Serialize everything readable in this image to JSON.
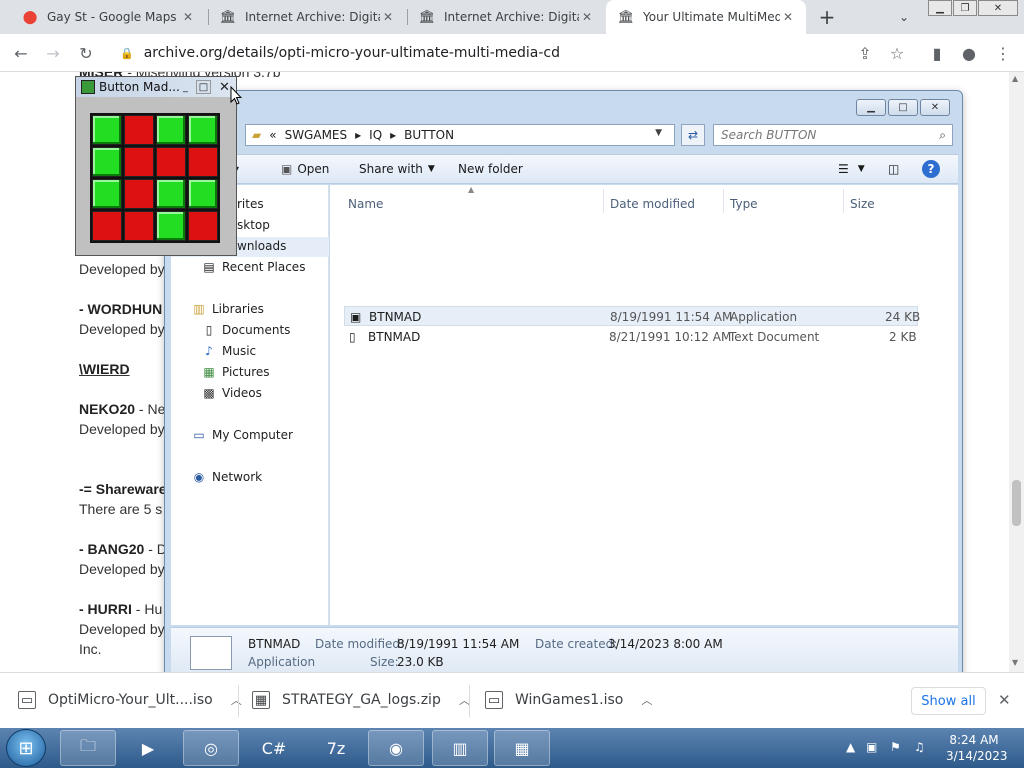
{
  "tabs": [
    {
      "label": "Gay St - Google Maps",
      "icon": "maps-pin-icon"
    },
    {
      "label": "Internet Archive: Digital L",
      "icon": "archive-icon"
    },
    {
      "label": "Internet Archive: Digital L",
      "icon": "archive-icon"
    },
    {
      "label": "Your Ultimate MultiMedia",
      "icon": "archive-icon",
      "active": true
    }
  ],
  "address": "archive.org/details/opti-micro-your-ultimate-multi-media-cd",
  "page": {
    "lines": [
      {
        "bold": "MISER",
        "text": " - MiserMind version 3.7b"
      },
      {
        "bold": "",
        "text": "Developed by"
      },
      {
        "bold": "- WORDHUN",
        "text": ""
      },
      {
        "bold": "",
        "text": "Developed by"
      },
      {
        "bold": "\\WIERD",
        "text": ""
      },
      {
        "bold": "NEKO20",
        "text": " - Ne"
      },
      {
        "bold": "",
        "text": "Developed by"
      },
      {
        "bold": "-= Shareware",
        "text": ""
      },
      {
        "bold": "",
        "text": "There are 5 s"
      },
      {
        "bold": "- BANG20",
        "text": " - D"
      },
      {
        "bold": "",
        "text": "Developed by"
      },
      {
        "bold": "- HURRI",
        "text": " - Hu"
      },
      {
        "bold": "",
        "text": "Developed by"
      },
      {
        "bold": "",
        "text": "Inc."
      }
    ]
  },
  "explorer": {
    "breadcrumb": [
      "«",
      "SWGAMES",
      "IQ",
      "BUTTON"
    ],
    "search_placeholder": "Search BUTTON",
    "commands": {
      "organize_fragment": "▾",
      "open": "Open",
      "share": "Share with",
      "new_folder": "New folder"
    },
    "nav": {
      "favorites_frag": "rites",
      "desktop_frag": "sktop",
      "downloads_frag": "wnloads",
      "recent": "Recent Places",
      "libraries": "Libraries",
      "documents": "Documents",
      "music": "Music",
      "pictures": "Pictures",
      "videos": "Videos",
      "computer": "My Computer",
      "network": "Network"
    },
    "columns": {
      "name": "Name",
      "date": "Date modified",
      "type": "Type",
      "size": "Size"
    },
    "files": [
      {
        "name": "BTNMAD",
        "date": "8/19/1991 11:54 AM",
        "type": "Application",
        "size": "24 KB",
        "icon": "application-icon"
      },
      {
        "name": "BTNMAD",
        "date": "8/21/1991 10:12 AM",
        "type": "Text Document",
        "size": "2 KB",
        "icon": "text-document-icon"
      }
    ],
    "details": {
      "name": "BTNMAD",
      "kind": "Application",
      "date_modified_label": "Date modified:",
      "date_modified": "8/19/1991 11:54 AM",
      "date_created_label": "Date created:",
      "date_created": "3/14/2023 8:00 AM",
      "size_label": "Size:",
      "size": "23.0 KB"
    }
  },
  "buttonmad": {
    "title": "Button Mad...",
    "grid": [
      [
        "g",
        "r",
        "g",
        "g"
      ],
      [
        "g",
        "r",
        "r",
        "r"
      ],
      [
        "g",
        "r",
        "g",
        "g"
      ],
      [
        "r",
        "r",
        "g",
        "r"
      ]
    ],
    "colors": {
      "on": "#22dd22",
      "off": "#dd1111"
    }
  },
  "downloads": [
    {
      "name": "OptiMicro-Your_Ult....iso"
    },
    {
      "name": "STRATEGY_GA_logs.zip"
    },
    {
      "name": "WinGames1.iso"
    }
  ],
  "show_all": "Show all",
  "clock": {
    "time": "8:24 AM",
    "date": "3/14/2023"
  }
}
